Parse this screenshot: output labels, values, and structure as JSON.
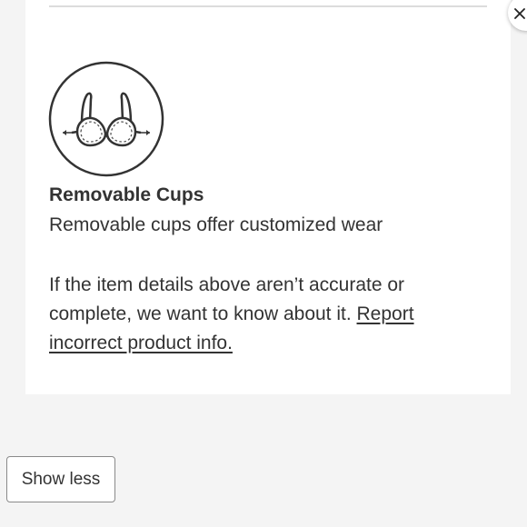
{
  "feature": {
    "icon": "removable-cups-icon",
    "title": "Removable Cups",
    "description": "Removable cups offer customized wear"
  },
  "notice": {
    "text": "If the item details above aren’t accurate or complete, we want to know about it. ",
    "link_label": "Report incorrect product info."
  },
  "buttons": {
    "show_less_label": "Show less",
    "close_icon": "close-icon"
  },
  "colors": {
    "page_background": "#f4f4f4",
    "card_background": "#ffffff",
    "text": "#333333",
    "divider": "#dcdcdc",
    "button_border": "#8a8a8a"
  }
}
